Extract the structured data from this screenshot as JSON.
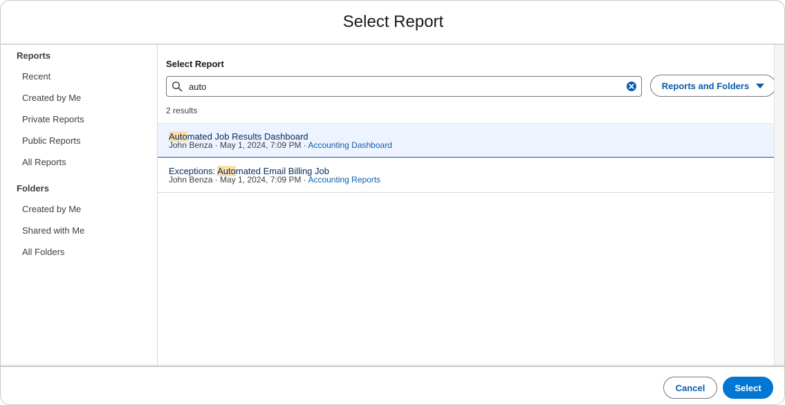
{
  "modal": {
    "title": "Select Report"
  },
  "sidebar": {
    "reports_heading": "Reports",
    "report_items": [
      "Recent",
      "Created by Me",
      "Private Reports",
      "Public Reports",
      "All Reports"
    ],
    "folders_heading": "Folders",
    "folder_items": [
      "Created by Me",
      "Shared with Me",
      "All Folders"
    ]
  },
  "search": {
    "label": "Select Report",
    "value": "auto",
    "scope_label": "Reports and Folders",
    "result_count": "2 results"
  },
  "results": [
    {
      "title_prefix": "",
      "title_match": "Auto",
      "title_rest": "mated Job Results Dashboard",
      "meta": "John Benza · May 1, 2024, 7:09 PM · ",
      "folder": "Accounting Dashboard",
      "selected": true
    },
    {
      "title_prefix": "Exceptions: ",
      "title_match": "Auto",
      "title_rest": "mated Email Billing Job",
      "meta": "John Benza · May 1, 2024, 7:09 PM · ",
      "folder": "Accounting Reports",
      "selected": false
    }
  ],
  "footer": {
    "cancel_label": "Cancel",
    "select_label": "Select"
  },
  "colors": {
    "brand_blue": "#0176d3",
    "link_blue": "#0b5cab",
    "highlight": "#fbdfa9",
    "selected_row": "#eef4ff"
  }
}
